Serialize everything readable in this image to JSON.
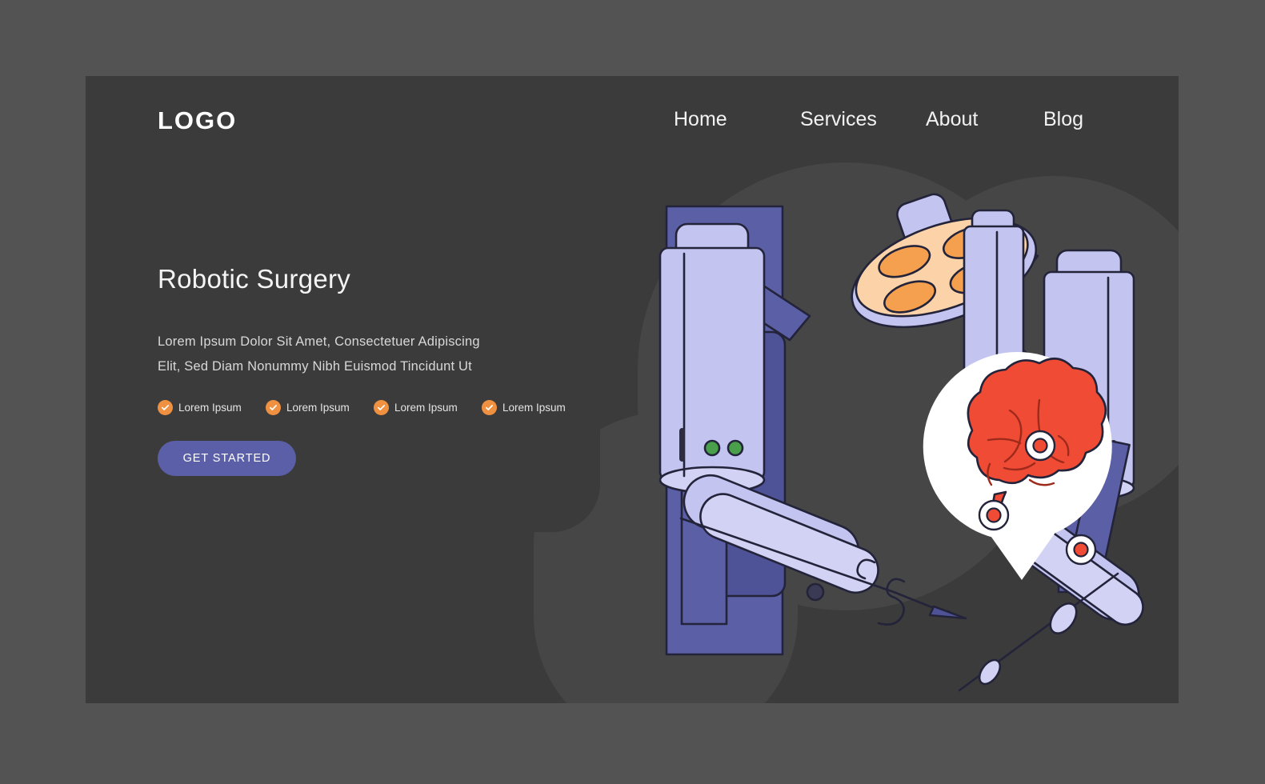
{
  "theme": {
    "page_background": "#535353",
    "card_background": "#3b3b3b",
    "blob_color": "#464646",
    "accent_orange": "#ef9140",
    "accent_indigo": "#5a5fa7",
    "robot_light": "#c3c4ef",
    "robot_dark": "#5b5fa6",
    "brain_red": "#ef4b35",
    "lamp_orange": "#f5a04f",
    "lamp_face": "#fcd3a8",
    "indicator_green": "#4aa04a",
    "text_primary": "#f4f4f4",
    "text_secondary": "#d8d8d8",
    "outline": "#23233a"
  },
  "header": {
    "logo": "LOGO",
    "nav": [
      {
        "label": "Home"
      },
      {
        "label": "Services"
      },
      {
        "label": "About"
      },
      {
        "label": "Blog"
      }
    ]
  },
  "hero": {
    "title": "Robotic Surgery",
    "subtitle": "Lorem Ipsum Dolor Sit Amet, Consectetuer Adipiscing Elit, Sed Diam Nonummy Nibh Euismod Tincidunt Ut",
    "features": [
      {
        "label": "Lorem Ipsum",
        "icon": "check-circle-icon"
      },
      {
        "label": "Lorem Ipsum",
        "icon": "check-circle-icon"
      },
      {
        "label": "Lorem Ipsum",
        "icon": "check-circle-icon"
      },
      {
        "label": "Lorem Ipsum",
        "icon": "check-circle-icon"
      }
    ],
    "cta_label": "GET STARTED"
  },
  "illustration": {
    "name": "robotic-surgery-illustration",
    "elements": [
      "surgical-lamp",
      "robot-column",
      "robot-arm-left",
      "robot-arm-top-right",
      "robot-arm-right",
      "instrument-needle-arm",
      "instrument-syringe-arm",
      "brain-speech-bubble"
    ],
    "brain_markers": 3,
    "lamp_bulbs": 4,
    "indicator_lights": 2
  }
}
